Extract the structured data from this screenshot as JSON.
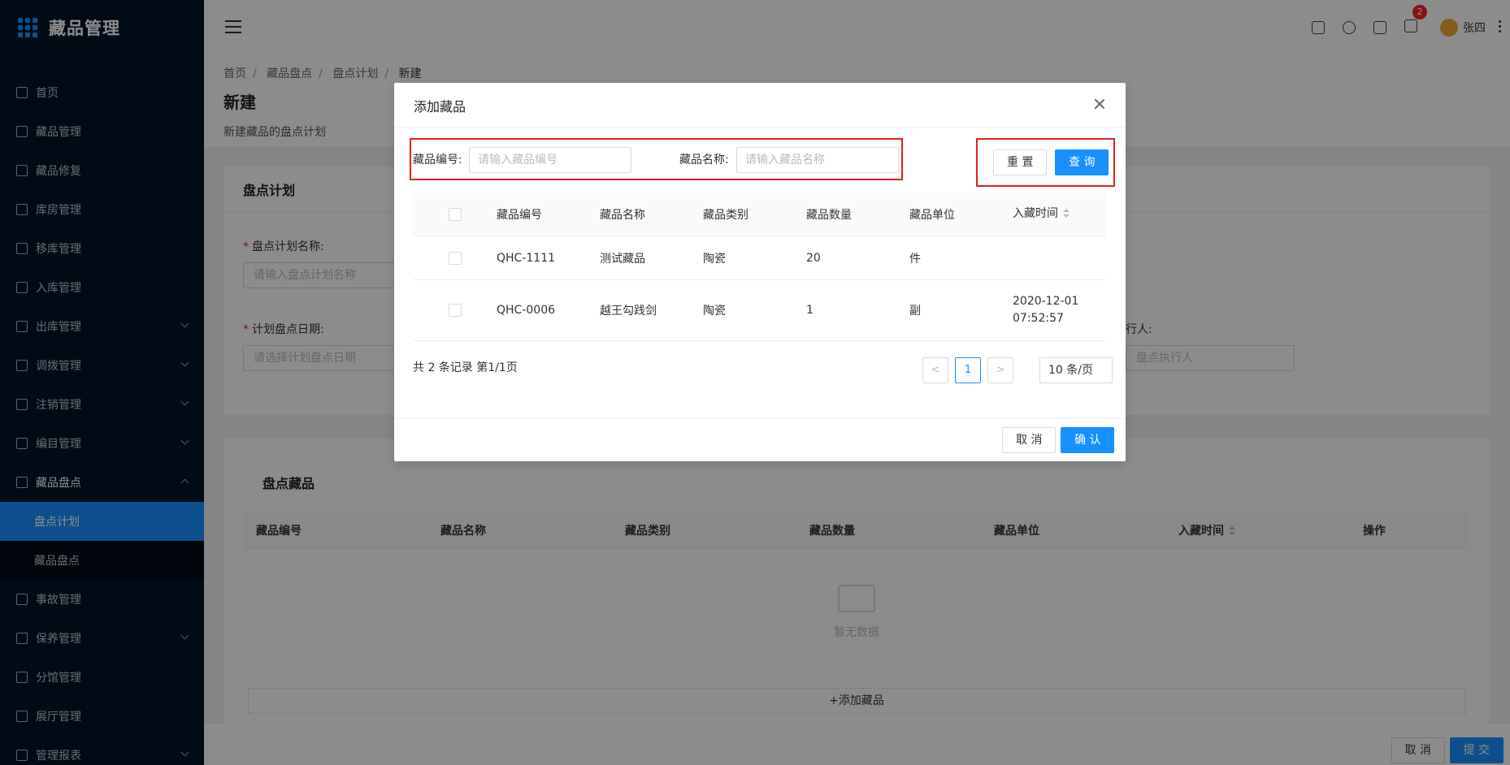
{
  "app": {
    "title": "藏品管理"
  },
  "sidebar": {
    "items": [
      {
        "label": "首页"
      },
      {
        "label": "藏品管理"
      },
      {
        "label": "藏品修复"
      },
      {
        "label": "库房管理"
      },
      {
        "label": "移库管理"
      },
      {
        "label": "入库管理"
      },
      {
        "label": "出库管理"
      },
      {
        "label": "调拨管理"
      },
      {
        "label": "注销管理"
      },
      {
        "label": "编目管理"
      },
      {
        "label": "藏品盘点"
      },
      {
        "label": "事故管理"
      },
      {
        "label": "保养管理"
      },
      {
        "label": "分馆管理"
      },
      {
        "label": "展厅管理"
      },
      {
        "label": "管理报表"
      }
    ],
    "submenu": [
      {
        "label": "盘点计划"
      },
      {
        "label": "藏品盘点"
      }
    ]
  },
  "header": {
    "notification_count": "2",
    "username": "张四"
  },
  "breadcrumb": [
    "首页",
    "藏品盘点",
    "盘点计划",
    "新建"
  ],
  "page": {
    "title": "新建",
    "description": "新建藏品的盘点计划"
  },
  "plan_card": {
    "title": "盘点计划",
    "name_label": "盘点计划名称:",
    "name_placeholder": "请输入盘点计划名称",
    "date_label": "计划盘点日期:",
    "date_placeholder": "请选择计划盘点日期",
    "executor_label_partial": "行人:",
    "executor_placeholder_partial": "盘点执行人"
  },
  "items_card": {
    "title": "盘点藏品",
    "columns": [
      "藏品编号",
      "藏品名称",
      "藏品类别",
      "藏品数量",
      "藏品单位",
      "入藏时间",
      "操作"
    ],
    "empty_text": "暂无数据",
    "add_label": "+添加藏品"
  },
  "footer": {
    "cancel": "取 消",
    "submit": "提 交"
  },
  "modal": {
    "title": "添加藏品",
    "search": {
      "code_label": "藏品编号:",
      "code_placeholder": "请输入藏品编号",
      "name_label": "藏品名称:",
      "name_placeholder": "请输入藏品名称",
      "reset": "重 置",
      "query": "查 询"
    },
    "columns": [
      "藏品编号",
      "藏品名称",
      "藏品类别",
      "藏品数量",
      "藏品单位",
      "入藏时间"
    ],
    "rows": [
      {
        "code": "QHC-1111",
        "name": "测试藏品",
        "category": "陶瓷",
        "quantity": "20",
        "unit": "件",
        "date": "",
        "time": ""
      },
      {
        "code": "QHC-0006",
        "name": "越王勾践剑",
        "category": "陶瓷",
        "quantity": "1",
        "unit": "副",
        "date": "2020-12-01",
        "time": "07:52:57"
      }
    ],
    "total_text": "共 2 条记录 第1/1页",
    "pager": {
      "prev": "<",
      "current": "1",
      "next": ">",
      "page_size": "10 条/页"
    },
    "cancel": "取 消",
    "confirm": "确 认"
  },
  "colors": {
    "accent": "#1890ff",
    "sidebar_bg": "#001529",
    "highlight_border": "#e02020",
    "badge": "#f5222d"
  }
}
